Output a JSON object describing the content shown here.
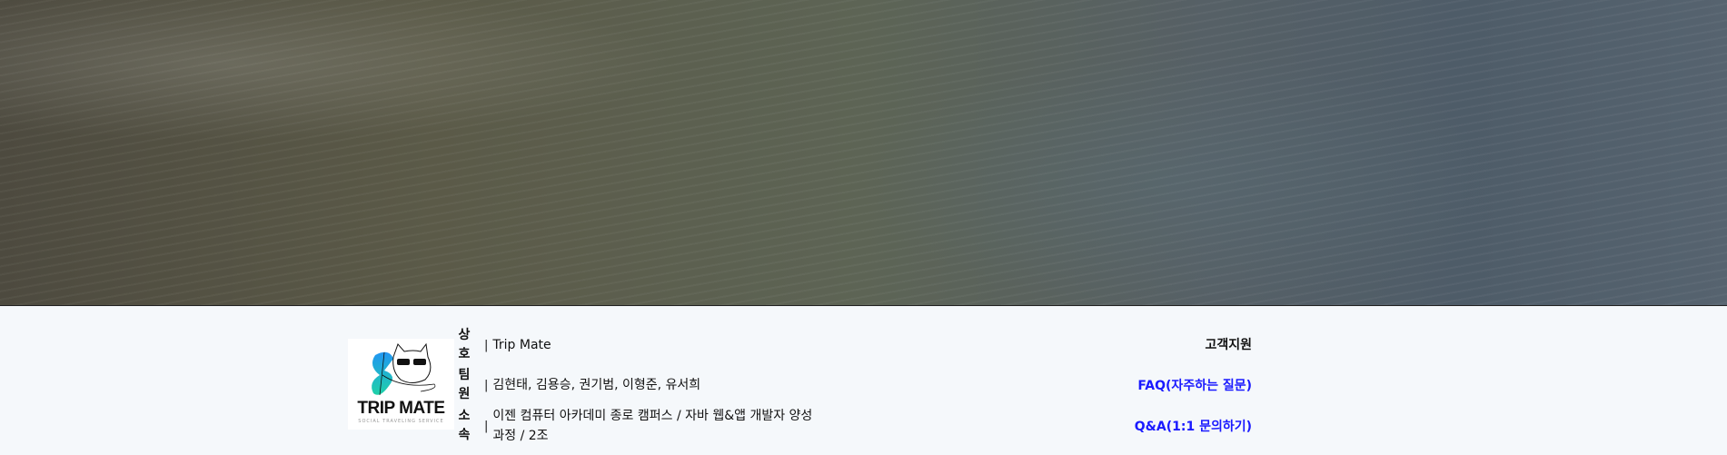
{
  "logo": {
    "title": "TRIP MATE",
    "subtitle": "SOCIAL TRAVELING SERVICE"
  },
  "info": [
    {
      "label": "상호",
      "value": "Trip Mate"
    },
    {
      "label": "팀원",
      "value": "김현태, 김용승, 권기범, 이형준, 유서희"
    },
    {
      "label": "소속",
      "value": "이젠 컴퓨터 아카데미 종로 캠퍼스 / 자바 웹&앱 개발자 양성 과정 / 2조"
    }
  ],
  "support": {
    "title": "고객지원",
    "links": [
      "FAQ(자주하는 질문)",
      "Q&A(1:1 문의하기)"
    ]
  },
  "separator": "|",
  "colors": {
    "link": "#1a1aff",
    "footer_bg": "#f5f8fb"
  }
}
